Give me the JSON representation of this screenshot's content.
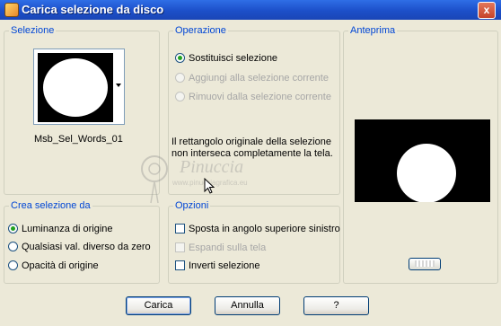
{
  "window": {
    "title": "Carica selezione da disco",
    "close_glyph": "x",
    "icon": "app-icon"
  },
  "selezione": {
    "legend": "Selezione",
    "filename": "Msb_Sel_Words_01"
  },
  "operazione": {
    "legend": "Operazione",
    "options": [
      {
        "label": "Sostituisci selezione",
        "selected": true,
        "enabled": true
      },
      {
        "label": "Aggiungi alla selezione corrente",
        "selected": false,
        "enabled": false
      },
      {
        "label": "Rimuovi dalla selezione corrente",
        "selected": false,
        "enabled": false
      }
    ],
    "message_line1": "Il rettangolo originale della selezione",
    "message_line2": "non interseca completamente la tela."
  },
  "anteprima": {
    "legend": "Anteprima"
  },
  "crea": {
    "legend": "Crea selezione da",
    "options": [
      {
        "label": "Luminanza di origine",
        "selected": true
      },
      {
        "label": "Qualsiasi val. diverso da zero",
        "selected": false
      },
      {
        "label": "Opacità di origine",
        "selected": false
      }
    ]
  },
  "opzioni": {
    "legend": "Opzioni",
    "options": [
      {
        "label": "Sposta in angolo superiore sinistro",
        "checked": false,
        "enabled": true
      },
      {
        "label": "Espandi sulla tela",
        "checked": false,
        "enabled": false
      },
      {
        "label": "Inverti selezione",
        "checked": false,
        "enabled": true
      }
    ]
  },
  "buttons": {
    "load": "Carica",
    "cancel": "Annulla",
    "help": "?"
  },
  "watermark": {
    "name": "Pinuccia",
    "site": "www.pinucciagrafica.eu"
  },
  "colors": {
    "titlebar": "#1c4fc9",
    "legend": "#0046d5",
    "dialog": "#ece9d8",
    "radio_dot": "#21a121"
  }
}
